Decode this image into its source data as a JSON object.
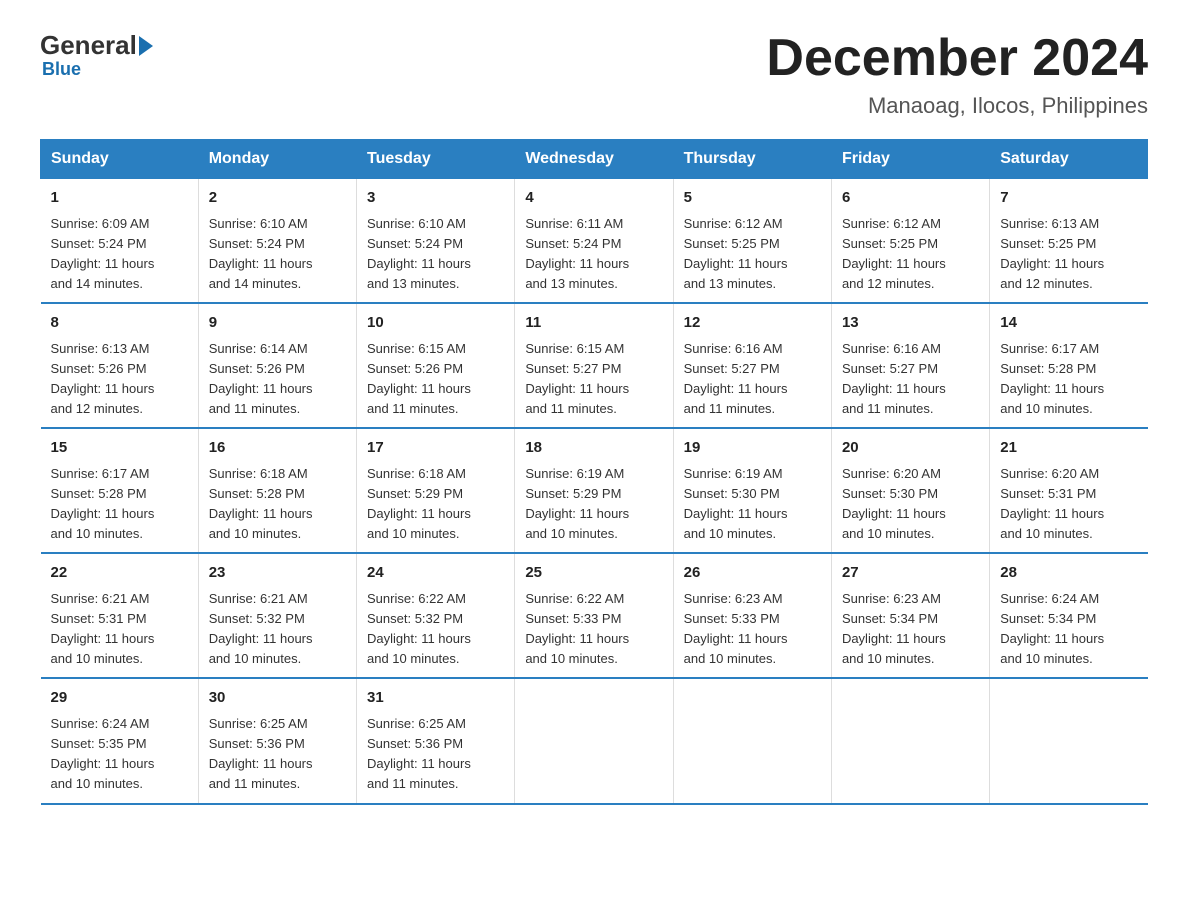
{
  "header": {
    "logo_general": "General",
    "logo_blue": "Blue",
    "main_title": "December 2024",
    "subtitle": "Manaoag, Ilocos, Philippines"
  },
  "days_of_week": [
    "Sunday",
    "Monday",
    "Tuesday",
    "Wednesday",
    "Thursday",
    "Friday",
    "Saturday"
  ],
  "weeks": [
    [
      {
        "day": "1",
        "sunrise": "6:09 AM",
        "sunset": "5:24 PM",
        "daylight": "11 hours and 14 minutes."
      },
      {
        "day": "2",
        "sunrise": "6:10 AM",
        "sunset": "5:24 PM",
        "daylight": "11 hours and 14 minutes."
      },
      {
        "day": "3",
        "sunrise": "6:10 AM",
        "sunset": "5:24 PM",
        "daylight": "11 hours and 13 minutes."
      },
      {
        "day": "4",
        "sunrise": "6:11 AM",
        "sunset": "5:24 PM",
        "daylight": "11 hours and 13 minutes."
      },
      {
        "day": "5",
        "sunrise": "6:12 AM",
        "sunset": "5:25 PM",
        "daylight": "11 hours and 13 minutes."
      },
      {
        "day": "6",
        "sunrise": "6:12 AM",
        "sunset": "5:25 PM",
        "daylight": "11 hours and 12 minutes."
      },
      {
        "day": "7",
        "sunrise": "6:13 AM",
        "sunset": "5:25 PM",
        "daylight": "11 hours and 12 minutes."
      }
    ],
    [
      {
        "day": "8",
        "sunrise": "6:13 AM",
        "sunset": "5:26 PM",
        "daylight": "11 hours and 12 minutes."
      },
      {
        "day": "9",
        "sunrise": "6:14 AM",
        "sunset": "5:26 PM",
        "daylight": "11 hours and 11 minutes."
      },
      {
        "day": "10",
        "sunrise": "6:15 AM",
        "sunset": "5:26 PM",
        "daylight": "11 hours and 11 minutes."
      },
      {
        "day": "11",
        "sunrise": "6:15 AM",
        "sunset": "5:27 PM",
        "daylight": "11 hours and 11 minutes."
      },
      {
        "day": "12",
        "sunrise": "6:16 AM",
        "sunset": "5:27 PM",
        "daylight": "11 hours and 11 minutes."
      },
      {
        "day": "13",
        "sunrise": "6:16 AM",
        "sunset": "5:27 PM",
        "daylight": "11 hours and 11 minutes."
      },
      {
        "day": "14",
        "sunrise": "6:17 AM",
        "sunset": "5:28 PM",
        "daylight": "11 hours and 10 minutes."
      }
    ],
    [
      {
        "day": "15",
        "sunrise": "6:17 AM",
        "sunset": "5:28 PM",
        "daylight": "11 hours and 10 minutes."
      },
      {
        "day": "16",
        "sunrise": "6:18 AM",
        "sunset": "5:28 PM",
        "daylight": "11 hours and 10 minutes."
      },
      {
        "day": "17",
        "sunrise": "6:18 AM",
        "sunset": "5:29 PM",
        "daylight": "11 hours and 10 minutes."
      },
      {
        "day": "18",
        "sunrise": "6:19 AM",
        "sunset": "5:29 PM",
        "daylight": "11 hours and 10 minutes."
      },
      {
        "day": "19",
        "sunrise": "6:19 AM",
        "sunset": "5:30 PM",
        "daylight": "11 hours and 10 minutes."
      },
      {
        "day": "20",
        "sunrise": "6:20 AM",
        "sunset": "5:30 PM",
        "daylight": "11 hours and 10 minutes."
      },
      {
        "day": "21",
        "sunrise": "6:20 AM",
        "sunset": "5:31 PM",
        "daylight": "11 hours and 10 minutes."
      }
    ],
    [
      {
        "day": "22",
        "sunrise": "6:21 AM",
        "sunset": "5:31 PM",
        "daylight": "11 hours and 10 minutes."
      },
      {
        "day": "23",
        "sunrise": "6:21 AM",
        "sunset": "5:32 PM",
        "daylight": "11 hours and 10 minutes."
      },
      {
        "day": "24",
        "sunrise": "6:22 AM",
        "sunset": "5:32 PM",
        "daylight": "11 hours and 10 minutes."
      },
      {
        "day": "25",
        "sunrise": "6:22 AM",
        "sunset": "5:33 PM",
        "daylight": "11 hours and 10 minutes."
      },
      {
        "day": "26",
        "sunrise": "6:23 AM",
        "sunset": "5:33 PM",
        "daylight": "11 hours and 10 minutes."
      },
      {
        "day": "27",
        "sunrise": "6:23 AM",
        "sunset": "5:34 PM",
        "daylight": "11 hours and 10 minutes."
      },
      {
        "day": "28",
        "sunrise": "6:24 AM",
        "sunset": "5:34 PM",
        "daylight": "11 hours and 10 minutes."
      }
    ],
    [
      {
        "day": "29",
        "sunrise": "6:24 AM",
        "sunset": "5:35 PM",
        "daylight": "11 hours and 10 minutes."
      },
      {
        "day": "30",
        "sunrise": "6:25 AM",
        "sunset": "5:36 PM",
        "daylight": "11 hours and 11 minutes."
      },
      {
        "day": "31",
        "sunrise": "6:25 AM",
        "sunset": "5:36 PM",
        "daylight": "11 hours and 11 minutes."
      },
      null,
      null,
      null,
      null
    ]
  ],
  "labels": {
    "sunrise": "Sunrise:",
    "sunset": "Sunset:",
    "daylight": "Daylight:"
  }
}
